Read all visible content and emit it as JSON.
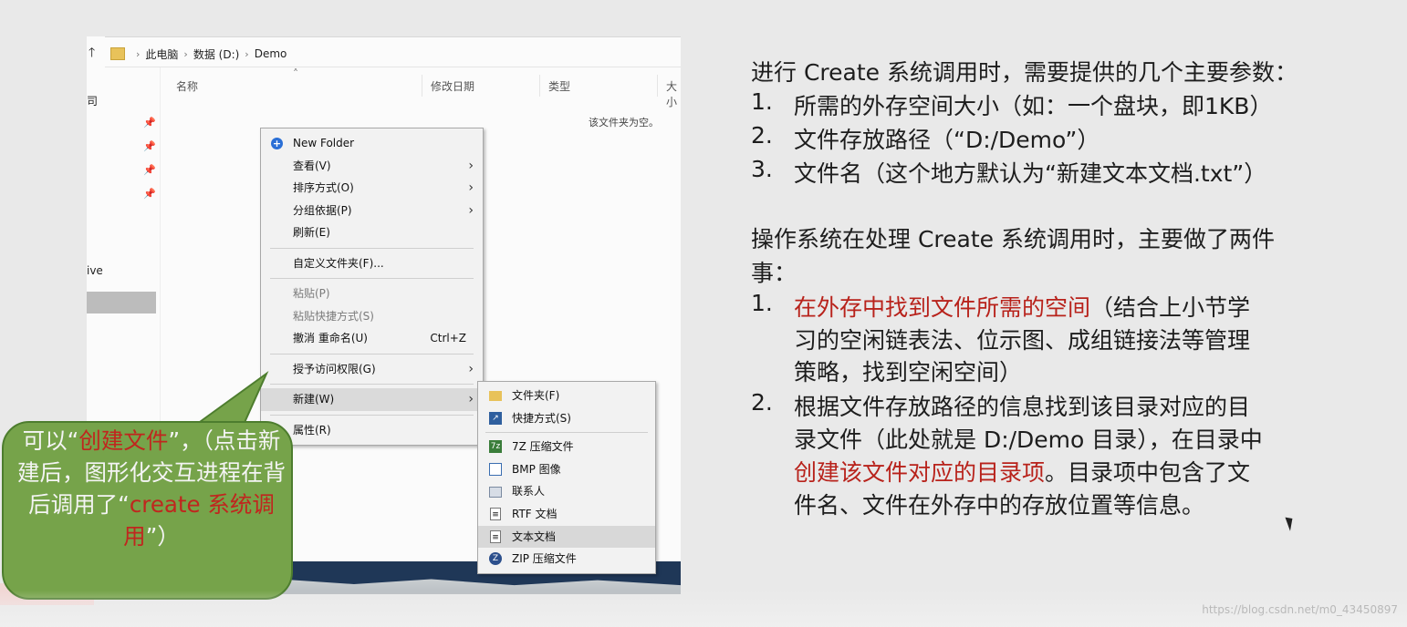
{
  "explorer": {
    "address": {
      "crumbs": [
        "此电脑",
        "数据 (D:)",
        "Demo"
      ]
    },
    "nav": {
      "label_top": "司",
      "label_drive": "ive"
    },
    "columns": {
      "name": "名称",
      "modified": "修改日期",
      "type": "类型",
      "size": "大小"
    },
    "empty_message": "该文件夹为空。"
  },
  "context_menu": {
    "items": [
      {
        "label": "New Folder",
        "icon": "new-folder-icon"
      },
      {
        "label": "查看(V)",
        "submenu": true
      },
      {
        "label": "排序方式(O)",
        "submenu": true
      },
      {
        "label": "分组依据(P)",
        "submenu": true
      },
      {
        "label": "刷新(E)"
      },
      {
        "label": "自定义文件夹(F)..."
      },
      {
        "label": "粘贴(P)",
        "disabled": true
      },
      {
        "label": "粘贴快捷方式(S)",
        "disabled": true
      },
      {
        "label": "撤消 重命名(U)",
        "shortcut": "Ctrl+Z"
      },
      {
        "label": "授予访问权限(G)",
        "submenu": true
      },
      {
        "label": "新建(W)",
        "submenu": true,
        "highlighted": true
      },
      {
        "label": "属性(R)"
      }
    ]
  },
  "new_submenu": {
    "items": [
      {
        "label": "文件夹(F)",
        "icon": "folder-icon"
      },
      {
        "label": "快捷方式(S)",
        "icon": "shortcut-icon"
      },
      {
        "label": "7Z 压缩文件",
        "icon": "archive-7z-icon"
      },
      {
        "label": "BMP 图像",
        "icon": "bmp-image-icon"
      },
      {
        "label": "联系人",
        "icon": "contact-icon"
      },
      {
        "label": "RTF 文档",
        "icon": "rtf-document-icon"
      },
      {
        "label": "文本文档",
        "icon": "text-document-icon",
        "highlighted": true
      },
      {
        "label": "ZIP 压缩文件",
        "icon": "zip-archive-icon"
      }
    ]
  },
  "callout": {
    "part1": "可以“",
    "part1_red": "创建文件",
    "part2": "”，（点击新建后，图形化交互进程在背后调用了“",
    "part2_red": "create 系统调用",
    "part3": "”）"
  },
  "notes": {
    "section1_title": "进行 Create 系统调用时，需要提供的几个主要参数：",
    "params": [
      {
        "num": "1.",
        "text": "所需的外存空间大小（如：一个盘块，即1KB）"
      },
      {
        "num": "2.",
        "text": "文件存放路径（“D:/Demo”）"
      },
      {
        "num": "3.",
        "text": "文件名（这个地方默认为“新建文本文档.txt”）"
      }
    ],
    "section2_title_l1": "操作系统在处理 Create 系统调用时，主要做了两件",
    "section2_title_l2": "事：",
    "step1_num": "1.",
    "step1_red": "在外存中找到文件所需的空间",
    "step1_l1_rest": "（结合上小节学",
    "step1_l2": "习的空闲链表法、位示图、成组链接法等管理",
    "step1_l3": "策略，找到空闲空间）",
    "step2_num": "2.",
    "step2_l1": "根据文件存放路径的信息找到该目录对应的目",
    "step2_l2": "录文件（此处就是 D:/Demo 目录），在目录中",
    "step2_l3_red": "创建该文件对应的目录项",
    "step2_l3_rest": "。目录项中包含了文",
    "step2_l4": "件名、文件在外存中的存放位置等信息。"
  },
  "watermark": "https://blog.csdn.net/m0_43450897",
  "colors": {
    "callout_bg": "#76a34a",
    "highlight_red": "#b8221b",
    "taskbar": "#1f3757"
  }
}
